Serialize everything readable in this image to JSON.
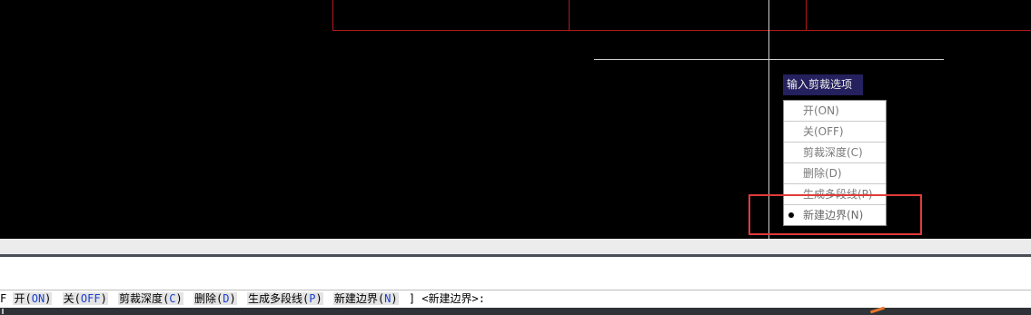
{
  "canvas": {
    "prompt_title": "输入剪裁选项",
    "menu_items": [
      {
        "label": "开(ON)",
        "selected": false
      },
      {
        "label": "关(OFF)",
        "selected": false
      },
      {
        "label": "剪裁深度(C)",
        "selected": false
      },
      {
        "label": "删除(D)",
        "selected": false
      },
      {
        "label": "生成多段线(P)",
        "selected": false
      },
      {
        "label": "新建边界(N)",
        "selected": true
      }
    ]
  },
  "command_line": {
    "leading_fragment": "F",
    "options": [
      {
        "name": "开",
        "key": "ON"
      },
      {
        "name": "关",
        "key": "OFF"
      },
      {
        "name": "剪裁深度",
        "key": "C"
      },
      {
        "name": "删除",
        "key": "D"
      },
      {
        "name": "生成多段线",
        "key": "P"
      },
      {
        "name": "新建边界",
        "key": "N"
      }
    ],
    "tail": "] <新建边界>:"
  },
  "colors": {
    "drawing_red": "#b3191c",
    "prompt_bg": "#25205e",
    "option_key": "#1a3fd1",
    "annotation": "#e03a3a"
  }
}
